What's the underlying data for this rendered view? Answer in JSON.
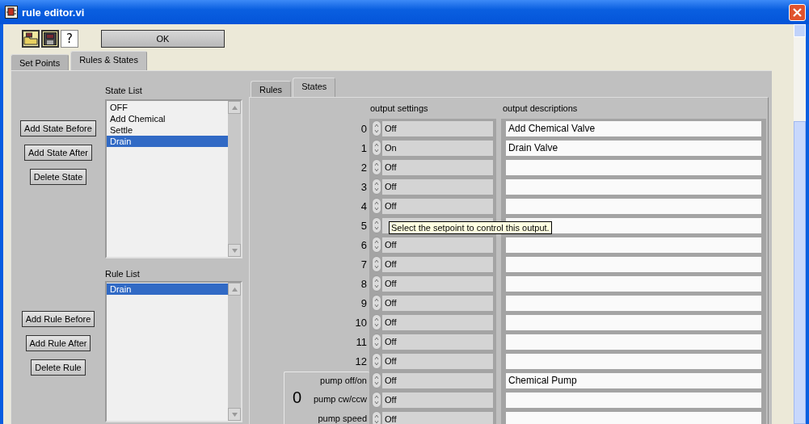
{
  "window": {
    "title": "rule editor.vi"
  },
  "toolbar": {
    "help_label": "?",
    "ok_button": "OK"
  },
  "tabs": [
    {
      "label": "Set Points",
      "selected": false
    },
    {
      "label": "Rules & States",
      "selected": true
    }
  ],
  "state_list": {
    "label": "State List",
    "items": [
      {
        "text": "OFF",
        "selected": false
      },
      {
        "text": "Add Chemical",
        "selected": false
      },
      {
        "text": "Settle",
        "selected": false
      },
      {
        "text": "Drain",
        "selected": true
      }
    ]
  },
  "state_buttons": [
    "Add State Before",
    "Add State After",
    "Delete State"
  ],
  "rule_list": {
    "label": "Rule List",
    "items": [
      {
        "text": "Drain",
        "selected": true
      }
    ]
  },
  "rule_buttons": [
    "Add Rule Before",
    "Add Rule After",
    "Delete Rule"
  ],
  "inner_tabs": [
    {
      "label": "Rules",
      "selected": false
    },
    {
      "label": "States",
      "selected": true
    }
  ],
  "outputs": {
    "settings_label": "output settings",
    "descriptions_label": "output descriptions",
    "rows": [
      {
        "index": "0",
        "setting": "Off",
        "description": "Add Chemical Valve"
      },
      {
        "index": "1",
        "setting": "On",
        "description": "Drain Valve"
      },
      {
        "index": "2",
        "setting": "Off"
      },
      {
        "index": "3",
        "setting": "Off"
      },
      {
        "index": "4",
        "setting": "Off"
      },
      {
        "index": "5"
      },
      {
        "index": "6",
        "setting": "Off"
      },
      {
        "index": "7",
        "setting": "Off"
      },
      {
        "index": "8",
        "setting": "Off"
      },
      {
        "index": "9",
        "setting": "Off"
      },
      {
        "index": "10",
        "setting": "Off"
      },
      {
        "index": "11",
        "setting": "Off"
      },
      {
        "index": "12",
        "setting": "Off"
      }
    ]
  },
  "pump": {
    "value": "0",
    "rows": [
      {
        "label": "pump off/on",
        "setting": "Off",
        "description": "Chemical Pump"
      },
      {
        "label": "pump cw/ccw",
        "setting": "Off"
      },
      {
        "label": "pump speed",
        "setting": "Off"
      }
    ]
  },
  "tooltip": "Select the setpoint to control this output."
}
